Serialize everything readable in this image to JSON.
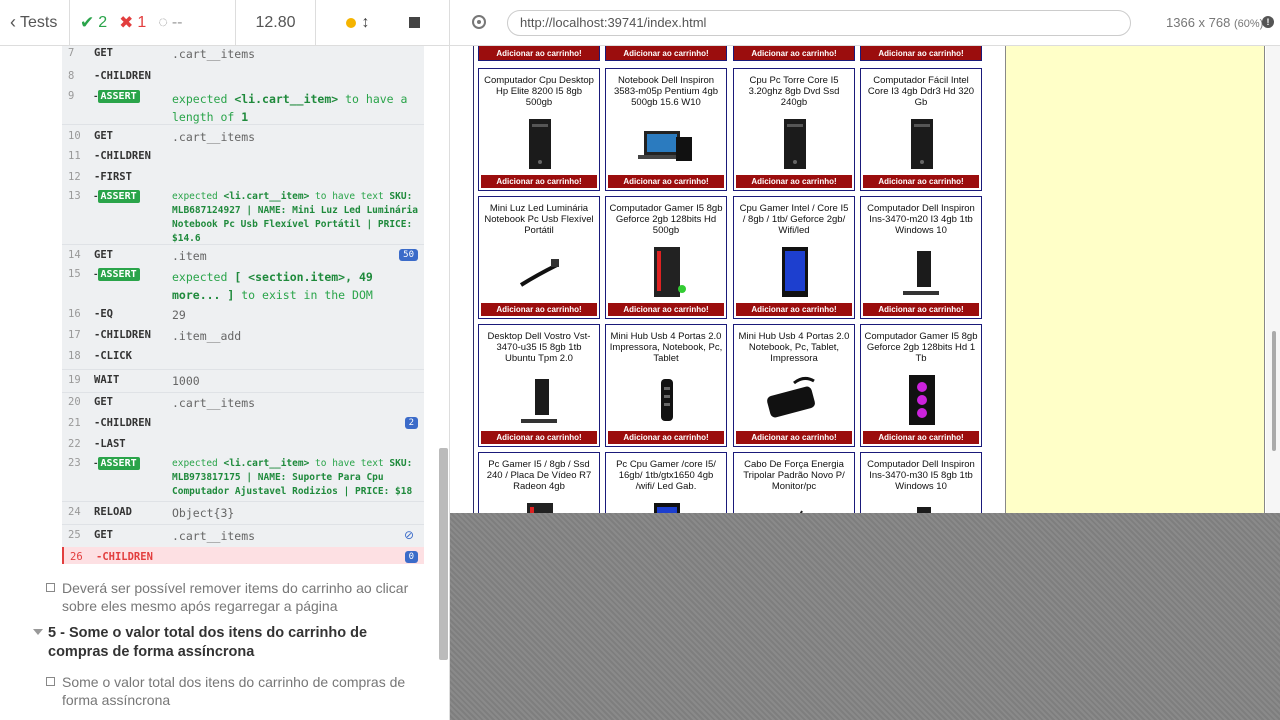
{
  "header": {
    "tests_label": "Tests",
    "passed": "2",
    "failed": "1",
    "pending": "--",
    "duration": "12.80"
  },
  "log": [
    {
      "num": "7",
      "name": "GET",
      "msg": ".cart__items"
    },
    {
      "num": "8",
      "name": "-CHILDREN",
      "msg": ""
    },
    {
      "num": "9",
      "name": "ASSERT",
      "msg_a": "expected",
      "msg_b": "<li.cart__item>",
      "msg_c": "to have a length of",
      "msg_d": "1"
    },
    {
      "num": "10",
      "name": "GET",
      "msg": ".cart__items"
    },
    {
      "num": "11",
      "name": "-CHILDREN",
      "msg": ""
    },
    {
      "num": "12",
      "name": "-FIRST",
      "msg": ""
    },
    {
      "num": "13",
      "name": "ASSERT",
      "msg_a": "expected",
      "msg_b": "<li.cart__item>",
      "msg_c": "to have text",
      "msg_d": "SKU: MLB687124927 | NAME: Mini Luz Led Luminária Notebook Pc Usb Flexível Portátil | PRICE: $14.6"
    },
    {
      "num": "14",
      "name": "GET",
      "msg": ".item",
      "badge": "50"
    },
    {
      "num": "15",
      "name": "ASSERT",
      "msg_a": "expected",
      "msg_b": "[ <section.item>, 49 more... ]",
      "msg_c": "to exist in the DOM",
      "msg_d": ""
    },
    {
      "num": "16",
      "name": "-EQ",
      "msg": "29"
    },
    {
      "num": "17",
      "name": "-CHILDREN",
      "msg": ".item__add"
    },
    {
      "num": "18",
      "name": "-CLICK",
      "msg": ""
    },
    {
      "num": "19",
      "name": "WAIT",
      "msg": "1000"
    },
    {
      "num": "20",
      "name": "GET",
      "msg": ".cart__items"
    },
    {
      "num": "21",
      "name": "-CHILDREN",
      "msg": "",
      "badge": "2"
    },
    {
      "num": "22",
      "name": "-LAST",
      "msg": ""
    },
    {
      "num": "23",
      "name": "ASSERT",
      "msg_a": "expected",
      "msg_b": "<li.cart__item>",
      "msg_c": "to have text",
      "msg_d": "SKU: MLB973817175 | NAME: Suporte Para Cpu Computador Ajustavel Rodizios | PRICE: $18"
    },
    {
      "num": "24",
      "name": "RELOAD",
      "msg": "Object{3}"
    },
    {
      "num": "25",
      "name": "GET",
      "msg": ".cart__items"
    },
    {
      "num": "26",
      "name": "-CHILDREN",
      "msg": "",
      "badge": "0"
    }
  ],
  "tests": {
    "remove_after_reload": "Deverá ser possível remover items do carrinho ao clicar sobre eles mesmo após regarregar a página",
    "suite5_title": "5 - Some o valor total dos itens do carrinho de compras de forma assíncrona",
    "sum_total": "Some o valor total dos itens do carrinho de compras de forma assíncrona"
  },
  "aut": {
    "url": "http://localhost:39741/index.html",
    "viewport": "1366 x 768",
    "scale": "(60%)",
    "add_label": "Adicionar ao carrinho!",
    "items": [
      {
        "title": "Computador Cpu Desktop Hp Elite 8200 I5 8gb 500gb",
        "pic": "tower"
      },
      {
        "title": "Notebook Dell Inspiron 3583-m05p Pentium 4gb 500gb 15.6 W10",
        "pic": "notebook"
      },
      {
        "title": "Cpu Pc Torre Core I5 3.20ghz 8gb Dvd Ssd 240gb",
        "pic": "tower"
      },
      {
        "title": "Computador Fácil Intel Core I3 4gb Ddr3 Hd 320 Gb",
        "pic": "tower"
      },
      {
        "title": "Mini Luz Led Luminária Notebook Pc Usb Flexível Portátil",
        "pic": "usb-led"
      },
      {
        "title": "Computador Gamer I5 8gb Geforce 2gb 128bits Hd 500gb",
        "pic": "gamer"
      },
      {
        "title": "Cpu Gamer Intel / Core I5 / 8gb / 1tb/ Geforce 2gb/ Wifi/led",
        "pic": "gamer-blue"
      },
      {
        "title": "Computador Dell Inspiron Ins-3470-m20 I3 4gb 1tb Windows 10",
        "pic": "small-tower"
      },
      {
        "title": "Desktop Dell Vostro Vst-3470-u35 I5 8gb 1tb Ubuntu Tpm 2.0",
        "pic": "small-tower"
      },
      {
        "title": "Mini Hub Usb 4 Portas 2.0 Impressora, Notebook, Pc, Tablet",
        "pic": "hub"
      },
      {
        "title": "Mini Hub Usb 4 Portas 2.0 Notebook, Pc, Tablet, Impressora",
        "pic": "hub2"
      },
      {
        "title": "Computador Gamer I5 8gb Geforce 2gb 128bits Hd 1 Tb",
        "pic": "gamer-rgb"
      },
      {
        "title": "Pc Gamer I5 / 8gb / Ssd 240 / Placa De Vídeo R7 Radeon 4gb",
        "pic": "gamer"
      },
      {
        "title": "Pc Cpu Gamer /core I5/ 16gb/ 1tb/gtx1650 4gb /wifi/ Led Gab.",
        "pic": "gamer-blue"
      },
      {
        "title": "Cabo De Força Energia Tripolar Padrão Novo P/ Monitor/pc",
        "pic": "cable"
      },
      {
        "title": "Computador Dell Inspiron Ins-3470-m30 I5 8gb 1tb Windows 10",
        "pic": "small-tower"
      }
    ]
  }
}
